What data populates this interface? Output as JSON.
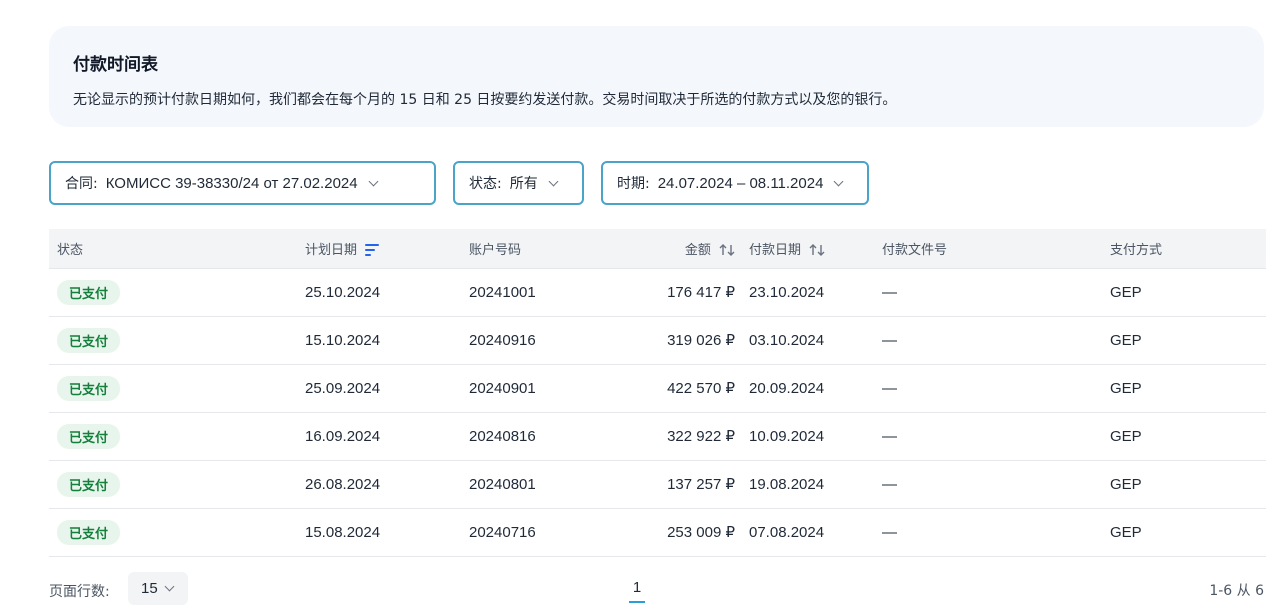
{
  "info": {
    "title": "付款时间表",
    "text": "无论显示的预计付款日期如何，我们都会在每个月的 15 日和 25 日按要约发送付款。交易时间取决于所选的付款方式以及您的银行。"
  },
  "filters": {
    "contract_label": "合同:",
    "contract_value": "КОМИСС 39-38330/24 от 27.02.2024",
    "status_label": "状态:",
    "status_value": "所有",
    "period_label": "时期:",
    "period_value": "24.07.2024 – 08.11.2024"
  },
  "table": {
    "headers": {
      "status": "状态",
      "plan_date": "计划日期",
      "account": "账户号码",
      "amount": "金额",
      "pay_date": "付款日期",
      "doc": "付款文件号",
      "method": "支付方式"
    },
    "rows": [
      {
        "status": "已支付",
        "plan_date": "25.10.2024",
        "account": "20241001",
        "amount": "176 417 ₽",
        "pay_date": "23.10.2024",
        "doc": "—",
        "method": "GEP"
      },
      {
        "status": "已支付",
        "plan_date": "15.10.2024",
        "account": "20240916",
        "amount": "319 026 ₽",
        "pay_date": "03.10.2024",
        "doc": "—",
        "method": "GEP"
      },
      {
        "status": "已支付",
        "plan_date": "25.09.2024",
        "account": "20240901",
        "amount": "422 570 ₽",
        "pay_date": "20.09.2024",
        "doc": "—",
        "method": "GEP"
      },
      {
        "status": "已支付",
        "plan_date": "16.09.2024",
        "account": "20240816",
        "amount": "322 922 ₽",
        "pay_date": "10.09.2024",
        "doc": "—",
        "method": "GEP"
      },
      {
        "status": "已支付",
        "plan_date": "26.08.2024",
        "account": "20240801",
        "amount": "137 257 ₽",
        "pay_date": "19.08.2024",
        "doc": "—",
        "method": "GEP"
      },
      {
        "status": "已支付",
        "plan_date": "15.08.2024",
        "account": "20240716",
        "amount": "253 009 ₽",
        "pay_date": "07.08.2024",
        "doc": "—",
        "method": "GEP"
      }
    ]
  },
  "footer": {
    "rows_label": "页面行数:",
    "rows_value": "15",
    "page": "1",
    "range": "1-6 从 6"
  },
  "colors": {
    "accent_border": "#4aa3c8",
    "badge_bg": "#e8f5ec",
    "badge_text": "#15803d",
    "sort_active": "#2563eb"
  }
}
